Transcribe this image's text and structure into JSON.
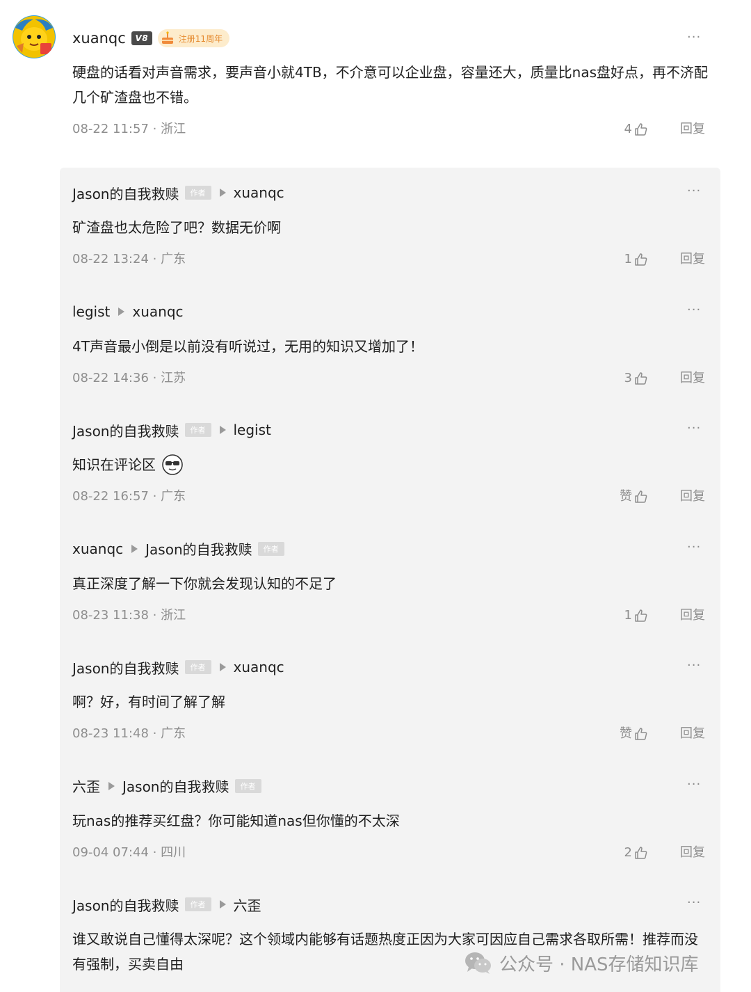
{
  "top_comment": {
    "username": "xuanqc",
    "level_badge": "V8",
    "anniversary_badge": "注册11周年",
    "more": "···",
    "body": "硬盘的话看对声音需求，要声音小就4TB，不介意可以企业盘，容量还大，质量比nas盘好点，再不济配几个矿渣盘也不错。",
    "date": "08-22 11:57",
    "location": "浙江",
    "likes": "4",
    "reply_label": "回复"
  },
  "replies": [
    {
      "from": "Jason的自我救赎",
      "from_is_author": true,
      "to": "xuanqc",
      "to_is_author": false,
      "text": "矿渣盘也太危险了吧？数据无价啊",
      "emoji": "",
      "date": "08-22 13:24",
      "location": "广东",
      "likes": "1"
    },
    {
      "from": "legist",
      "from_is_author": false,
      "to": "xuanqc",
      "to_is_author": false,
      "text": "4T声音最小倒是以前没有听说过，无用的知识又增加了！",
      "emoji": "",
      "date": "08-22 14:36",
      "location": "江苏",
      "likes": "3"
    },
    {
      "from": "Jason的自我救赎",
      "from_is_author": true,
      "to": "legist",
      "to_is_author": false,
      "text": "知识在评论区",
      "emoji": "sunglasses-emoji",
      "date": "08-22 16:57",
      "location": "广东",
      "likes": "赞"
    },
    {
      "from": "xuanqc",
      "from_is_author": false,
      "to": "Jason的自我救赎",
      "to_is_author": true,
      "text": "真正深度了解一下你就会发现认知的不足了",
      "emoji": "",
      "date": "08-23 11:38",
      "location": "浙江",
      "likes": "1"
    },
    {
      "from": "Jason的自我救赎",
      "from_is_author": true,
      "to": "xuanqc",
      "to_is_author": false,
      "text": "啊？好，有时间了解了解",
      "emoji": "",
      "date": "08-23 11:48",
      "location": "广东",
      "likes": "赞"
    },
    {
      "from": "六歪",
      "from_is_author": false,
      "to": "Jason的自我救赎",
      "to_is_author": true,
      "text": "玩nas的推荐买红盘？你可能知道nas但你懂的不太深",
      "emoji": "",
      "date": "09-04 07:44",
      "location": "四川",
      "likes": "2"
    },
    {
      "from": "Jason的自我救赎",
      "from_is_author": true,
      "to": "六歪",
      "to_is_author": false,
      "text": "谁又敢说自己懂得太深呢？这个领域内能够有话题热度正因为大家可因应自己需求各取所需！推荐而没有强制，买卖自由",
      "emoji": "",
      "date": "",
      "location": "",
      "likes": ""
    }
  ],
  "labels": {
    "author_tag": "作者",
    "reply": "回复",
    "more": "···",
    "dot_separator": " · "
  },
  "watermark": {
    "text": "公众号 · NAS存储知识库",
    "icon": "wechat-icon"
  },
  "colors": {
    "panel_bg": "#f3f3f3",
    "meta_text": "#8e8e8e",
    "anniv_bg": "#fdeccc",
    "anniv_text": "#e58a2e"
  }
}
